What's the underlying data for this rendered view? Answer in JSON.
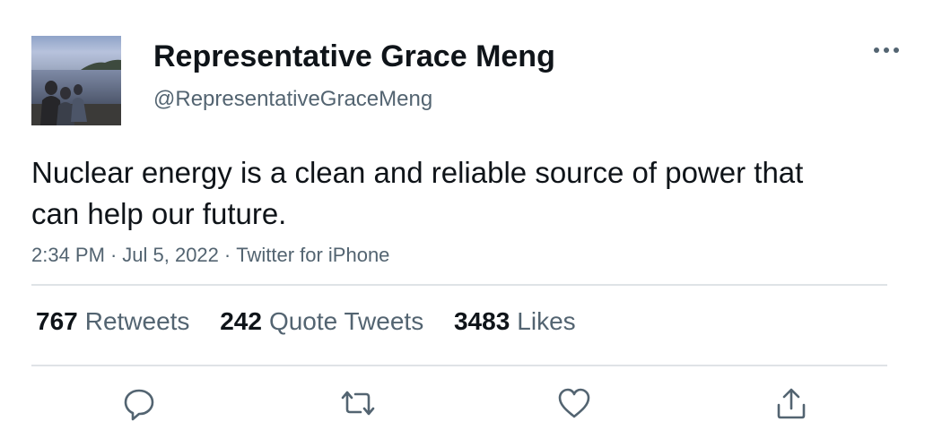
{
  "author": {
    "display_name": "Representative Grace Meng",
    "handle": "@RepresentativeGraceMeng",
    "avatar_icon": "profile-photo"
  },
  "tweet": {
    "text": "Nuclear energy is a clean and reliable source of power that can help our future."
  },
  "meta": {
    "time": "2:34 PM",
    "date": "Jul 5, 2022",
    "source": "Twitter for iPhone",
    "separator": "·"
  },
  "stats": {
    "retweets": {
      "count": "767",
      "label": "Retweets"
    },
    "quote_tweets": {
      "count": "242",
      "label": "Quote Tweets"
    },
    "likes": {
      "count": "3483",
      "label": "Likes"
    }
  },
  "actions": {
    "reply_icon": "reply-icon",
    "retweet_icon": "retweet-icon",
    "like_icon": "heart-icon",
    "share_icon": "share-icon"
  },
  "colors": {
    "text_primary": "#0f1419",
    "text_secondary": "#536471",
    "divider": "#dfe3e6",
    "icon": "#536471"
  }
}
